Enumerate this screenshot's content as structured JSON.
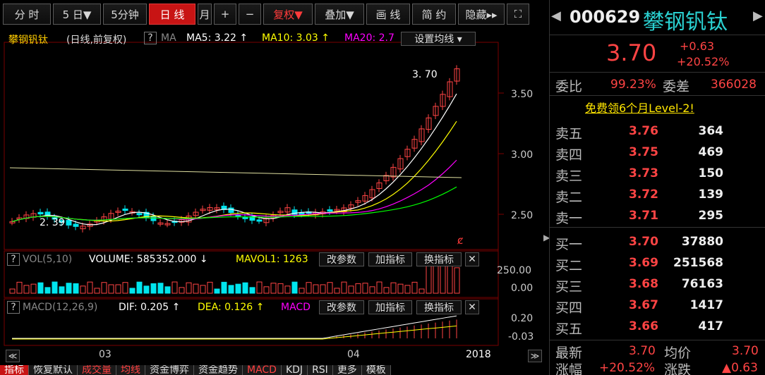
{
  "toolbar": {
    "buttons": [
      {
        "label": "分 时"
      },
      {
        "label": "5 日▼"
      },
      {
        "label": "5分钟"
      },
      {
        "label": "日 线"
      },
      {
        "label": "月"
      },
      {
        "label": "+"
      },
      {
        "label": "−"
      },
      {
        "label": "复权▼"
      },
      {
        "label": "叠加▼"
      },
      {
        "label": "画 线"
      },
      {
        "label": "简 约"
      },
      {
        "label": "隐藏▸▸"
      },
      {
        "label": "⛶"
      }
    ]
  },
  "kline": {
    "stock_name": "攀钢钒钛",
    "mode": "(日线,前复权)",
    "help": "?",
    "ma_label": "MA",
    "ma5": "MA5: 3.22 ↑",
    "ma10": "MA10: 3.03 ↑",
    "ma20": "MA20: 2.7",
    "ma_setting": "设置均线 ▾",
    "last_price_tag": "3. 70",
    "low_price_tag": "2. 39",
    "y_ticks": [
      "3.50",
      "3.00",
      "2.50"
    ],
    "arrow_mark": "ȼ"
  },
  "volume": {
    "help": "?",
    "title": "VOL(5,10)",
    "volume_text": "VOLUME: 585352.000 ↓",
    "mavol": "MAVOL1: 1263",
    "param_btn": "改参数",
    "add_btn": "加指标",
    "swap_btn": "换指标",
    "close": "✕",
    "y_ticks": [
      "250.00",
      "0.00"
    ]
  },
  "macd": {
    "help": "?",
    "title": "MACD(12,26,9)",
    "dif": "DIF: 0.205 ↑",
    "dea": "DEA: 0.126 ↑",
    "macd_label": "MACD",
    "param_btn": "改参数",
    "add_btn": "加指标",
    "swap_btn": "换指标",
    "close": "✕",
    "y_ticks": [
      "0.20",
      "-0.03"
    ]
  },
  "x_axis": {
    "left_arrow": "≪",
    "right_arrow": "≫",
    "ticks": [
      "03",
      "04"
    ],
    "year": "2018"
  },
  "bottom_tabs": [
    "指标",
    "恢复默认",
    "成交量",
    "均线",
    "资金博弈",
    "资金趋势",
    "MACD",
    "KDJ",
    "RSI",
    "更多",
    "模板"
  ],
  "quote": {
    "code": "000629",
    "name": "攀钢钒钛",
    "price": "3.70",
    "change": "+0.63",
    "change_pct": "+20.52%",
    "weibi_label": "委比",
    "weibi": "99.23%",
    "weicha_label": "委差",
    "weicha": "366028",
    "promo": "免费领6个月Level-2!",
    "asks": [
      {
        "label": "卖五",
        "price": "3.76",
        "vol": "364"
      },
      {
        "label": "卖四",
        "price": "3.75",
        "vol": "469"
      },
      {
        "label": "卖三",
        "price": "3.73",
        "vol": "150"
      },
      {
        "label": "卖二",
        "price": "3.72",
        "vol": "139"
      },
      {
        "label": "卖一",
        "price": "3.71",
        "vol": "295"
      }
    ],
    "bids": [
      {
        "label": "买一",
        "price": "3.70",
        "vol": "37880"
      },
      {
        "label": "买二",
        "price": "3.69",
        "vol": "251568"
      },
      {
        "label": "买三",
        "price": "3.68",
        "vol": "76163"
      },
      {
        "label": "买四",
        "price": "3.67",
        "vol": "1417"
      },
      {
        "label": "买五",
        "price": "3.66",
        "vol": "417"
      }
    ],
    "latest_label": "最新",
    "latest": "3.70",
    "avg_label": "均价",
    "avg": "3.70",
    "pct_label": "涨幅",
    "pct": "+20.52%",
    "chg_label": "涨跌",
    "chg": "▲0.63"
  },
  "colors": {
    "up": "#ff4444",
    "down": "#00e5ee",
    "ma5": "#ffffff",
    "ma10": "#ffff00",
    "ma20": "#ff00ff",
    "accent": "#c81414"
  }
}
